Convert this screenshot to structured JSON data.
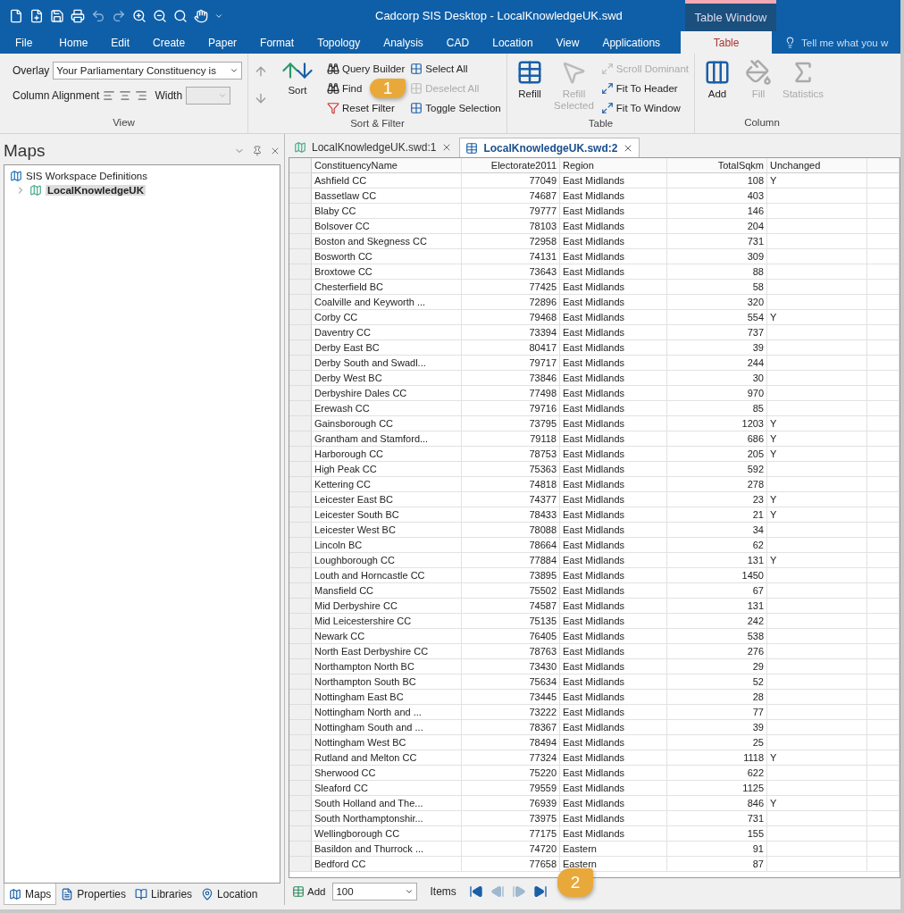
{
  "window": {
    "title": "Cadcorp SIS Desktop - LocalKnowledgeUK.swd",
    "context_tab": "Table Window"
  },
  "menu_tabs": [
    {
      "label": "File",
      "selected": false
    },
    {
      "label": "Home",
      "selected": false
    },
    {
      "label": "Edit",
      "selected": false
    },
    {
      "label": "Create",
      "selected": false
    },
    {
      "label": "Paper",
      "selected": false
    },
    {
      "label": "Format",
      "selected": false
    },
    {
      "label": "Topology",
      "selected": false
    },
    {
      "label": "Analysis",
      "selected": false
    },
    {
      "label": "CAD",
      "selected": false
    },
    {
      "label": "Location",
      "selected": false
    },
    {
      "label": "View",
      "selected": false
    },
    {
      "label": "Applications",
      "selected": false
    },
    {
      "label": "Table",
      "selected": true
    }
  ],
  "tell_me": {
    "placeholder": "Tell me what you w"
  },
  "ribbon": {
    "view": {
      "label": "View",
      "overlay_label": "Overlay",
      "overlay_value": "Your Parliamentary Constituency is",
      "alignment_label": "Column Alignment",
      "width_label": "Width"
    },
    "sort_filter": {
      "label": "Sort & Filter",
      "sort": "Sort",
      "buttons": [
        {
          "label": "Query Builder",
          "disabled": false
        },
        {
          "label": "Find",
          "disabled": false
        },
        {
          "label": "Reset Filter",
          "disabled": false
        },
        {
          "label": "Select All",
          "disabled": false
        },
        {
          "label": "Deselect All",
          "disabled": true
        },
        {
          "label": "Toggle Selection",
          "disabled": false
        }
      ]
    },
    "table": {
      "label": "Table",
      "big": [
        {
          "label": "Refill",
          "disabled": false
        },
        {
          "label": "Refill Selected",
          "disabled": true
        }
      ],
      "buttons": [
        {
          "label": "Scroll Dominant",
          "disabled": true
        },
        {
          "label": "Fit To Header",
          "disabled": false
        },
        {
          "label": "Fit To Window",
          "disabled": false
        }
      ]
    },
    "column": {
      "label": "Column",
      "big": [
        {
          "label": "Add",
          "disabled": false
        },
        {
          "label": "Fill",
          "disabled": true
        },
        {
          "label": "Statistics",
          "disabled": true
        }
      ]
    }
  },
  "maps_pane": {
    "title": "Maps",
    "tree": [
      {
        "label": "SIS Workspace Definitions",
        "children": [
          {
            "label": "LocalKnowledgeUK",
            "selected": true,
            "expanded": false
          }
        ]
      }
    ],
    "tabs": [
      {
        "label": "Maps",
        "selected": true
      },
      {
        "label": "Properties",
        "selected": false
      },
      {
        "label": "Libraries",
        "selected": false
      },
      {
        "label": "Location",
        "selected": false
      }
    ]
  },
  "doc_tabs": [
    {
      "label": "LocalKnowledgeUK.swd:1",
      "selected": false
    },
    {
      "label": "LocalKnowledgeUK.swd:2",
      "selected": true
    }
  ],
  "table": {
    "columns": [
      "ConstituencyName",
      "Electorate2011",
      "Region",
      "TotalSqkm",
      "Unchanged"
    ],
    "rows": [
      [
        "Ashfield CC",
        "77049",
        "East Midlands",
        "108",
        "Y"
      ],
      [
        "Bassetlaw CC",
        "74687",
        "East Midlands",
        "403",
        ""
      ],
      [
        "Blaby CC",
        "79777",
        "East Midlands",
        "146",
        ""
      ],
      [
        "Bolsover CC",
        "78103",
        "East Midlands",
        "204",
        ""
      ],
      [
        "Boston and Skegness CC",
        "72958",
        "East Midlands",
        "731",
        ""
      ],
      [
        "Bosworth CC",
        "74131",
        "East Midlands",
        "309",
        ""
      ],
      [
        "Broxtowe CC",
        "73643",
        "East Midlands",
        "88",
        ""
      ],
      [
        "Chesterfield BC",
        "77425",
        "East Midlands",
        "58",
        ""
      ],
      [
        "Coalville and Keyworth ...",
        "72896",
        "East Midlands",
        "320",
        ""
      ],
      [
        "Corby CC",
        "79468",
        "East Midlands",
        "554",
        "Y"
      ],
      [
        "Daventry CC",
        "73394",
        "East Midlands",
        "737",
        ""
      ],
      [
        "Derby East BC",
        "80417",
        "East Midlands",
        "39",
        ""
      ],
      [
        "Derby South and Swadl...",
        "79717",
        "East Midlands",
        "244",
        ""
      ],
      [
        "Derby West BC",
        "73846",
        "East Midlands",
        "30",
        ""
      ],
      [
        "Derbyshire Dales CC",
        "77498",
        "East Midlands",
        "970",
        ""
      ],
      [
        "Erewash CC",
        "79716",
        "East Midlands",
        "85",
        ""
      ],
      [
        "Gainsborough CC",
        "73795",
        "East Midlands",
        "1203",
        "Y"
      ],
      [
        "Grantham and Stamford...",
        "79118",
        "East Midlands",
        "686",
        "Y"
      ],
      [
        "Harborough CC",
        "78753",
        "East Midlands",
        "205",
        "Y"
      ],
      [
        "High Peak CC",
        "75363",
        "East Midlands",
        "592",
        ""
      ],
      [
        "Kettering CC",
        "74818",
        "East Midlands",
        "278",
        ""
      ],
      [
        "Leicester East BC",
        "74377",
        "East Midlands",
        "23",
        "Y"
      ],
      [
        "Leicester South BC",
        "78433",
        "East Midlands",
        "21",
        "Y"
      ],
      [
        "Leicester West BC",
        "78088",
        "East Midlands",
        "34",
        ""
      ],
      [
        "Lincoln BC",
        "78664",
        "East Midlands",
        "62",
        ""
      ],
      [
        "Loughborough CC",
        "77884",
        "East Midlands",
        "131",
        "Y"
      ],
      [
        "Louth and Horncastle CC",
        "73895",
        "East Midlands",
        "1450",
        ""
      ],
      [
        "Mansfield CC",
        "75502",
        "East Midlands",
        "67",
        ""
      ],
      [
        "Mid Derbyshire CC",
        "74587",
        "East Midlands",
        "131",
        ""
      ],
      [
        "Mid Leicestershire CC",
        "75135",
        "East Midlands",
        "242",
        ""
      ],
      [
        "Newark CC",
        "76405",
        "East Midlands",
        "538",
        ""
      ],
      [
        "North East Derbyshire CC",
        "78763",
        "East Midlands",
        "276",
        ""
      ],
      [
        "Northampton North BC",
        "73430",
        "East Midlands",
        "29",
        ""
      ],
      [
        "Northampton South BC",
        "75634",
        "East Midlands",
        "52",
        ""
      ],
      [
        "Nottingham East BC",
        "73445",
        "East Midlands",
        "28",
        ""
      ],
      [
        "Nottingham North and ...",
        "73222",
        "East Midlands",
        "77",
        ""
      ],
      [
        "Nottingham South and ...",
        "78367",
        "East Midlands",
        "39",
        ""
      ],
      [
        "Nottingham West BC",
        "78494",
        "East Midlands",
        "25",
        ""
      ],
      [
        "Rutland and Melton CC",
        "77324",
        "East Midlands",
        "1118",
        "Y"
      ],
      [
        "Sherwood CC",
        "75220",
        "East Midlands",
        "622",
        ""
      ],
      [
        "Sleaford CC",
        "79559",
        "East Midlands",
        "1125",
        ""
      ],
      [
        "South Holland and The...",
        "76939",
        "East Midlands",
        "846",
        "Y"
      ],
      [
        "South Northamptonshir...",
        "73975",
        "East Midlands",
        "731",
        ""
      ],
      [
        "Wellingborough CC",
        "77175",
        "East Midlands",
        "155",
        ""
      ],
      [
        "Basildon and Thurrock ...",
        "74720",
        "Eastern",
        "91",
        ""
      ],
      [
        "Bedford CC",
        "77658",
        "Eastern",
        "87",
        ""
      ]
    ]
  },
  "footer": {
    "add": "Add",
    "page_size": "100",
    "items_label": "Items",
    "nav": [
      {
        "kind": "first",
        "disabled": false
      },
      {
        "kind": "prev",
        "disabled": true
      },
      {
        "kind": "next",
        "disabled": true
      },
      {
        "kind": "last",
        "disabled": false
      }
    ]
  },
  "callouts": [
    {
      "label": "1"
    },
    {
      "label": "2"
    }
  ]
}
